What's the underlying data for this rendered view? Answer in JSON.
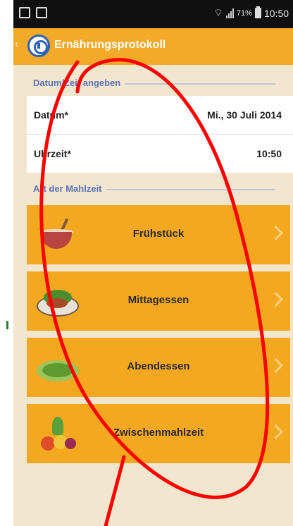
{
  "status_bar": {
    "battery": "71%",
    "time": "10:50"
  },
  "action_bar": {
    "back": "‹",
    "title": "Ernährungsprotokoll"
  },
  "sections": {
    "datetime_header": "Datum/Zeit angeben",
    "meal_header": "Art der Mahlzeit"
  },
  "fields": [
    {
      "label": "Datum*",
      "value": "Mi., 30 Juli 2014"
    },
    {
      "label": "Uhrzeit*",
      "value": "10:50"
    }
  ],
  "meals": [
    {
      "label": "Frühstück",
      "icon": "breakfast-bowl-icon"
    },
    {
      "label": "Mittagessen",
      "icon": "lunch-plate-icon"
    },
    {
      "label": "Abendessen",
      "icon": "dinner-salad-icon"
    },
    {
      "label": "Zwischenmahlzeit",
      "icon": "snack-fruits-icon"
    }
  ],
  "colors": {
    "accent": "#f4a81f",
    "background": "#f2e6cf",
    "header_text": "#5b72b6",
    "annotation": "#ff0000"
  }
}
